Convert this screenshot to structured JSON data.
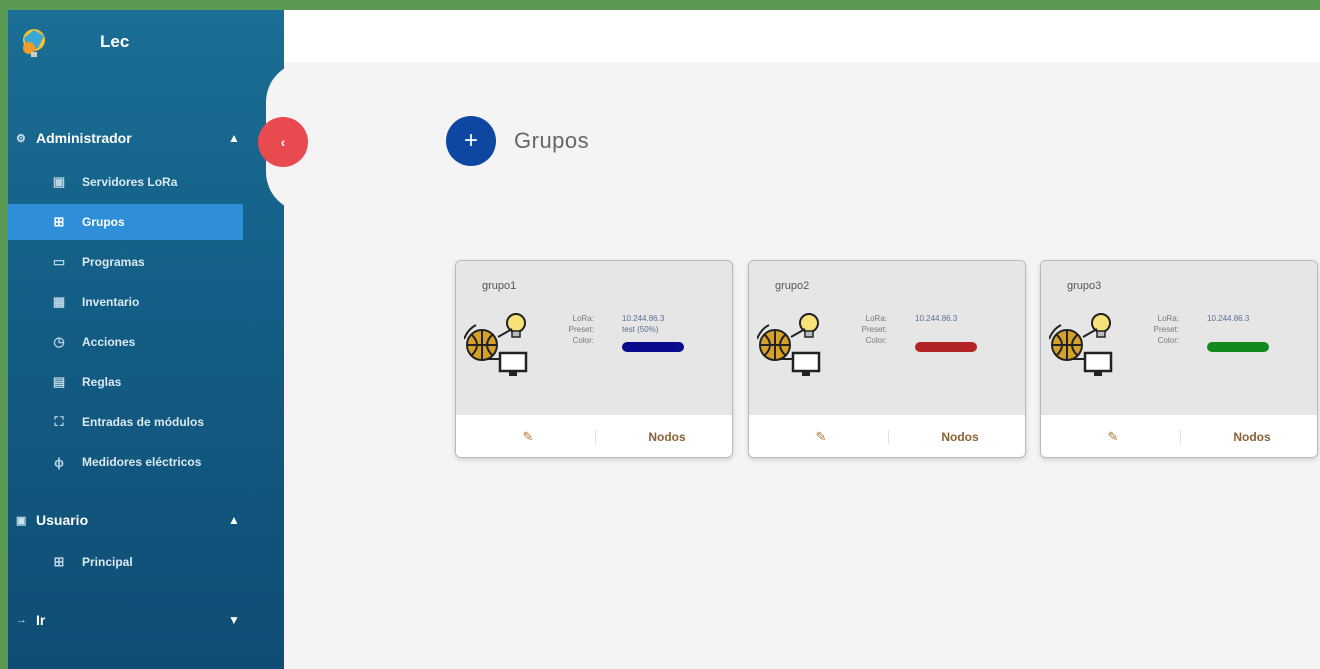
{
  "app": {
    "name": "Lec"
  },
  "sidebar": {
    "collapse_icon": "‹",
    "sections": [
      {
        "label": "Administrador",
        "icon": "⚙",
        "chevron": "▲",
        "items": [
          {
            "label": "Servidores LoRa",
            "icon": "▣"
          },
          {
            "label": "Grupos",
            "icon": "⊞",
            "active": true
          },
          {
            "label": "Programas",
            "icon": "▭"
          },
          {
            "label": "Inventario",
            "icon": "▦"
          },
          {
            "label": "Acciones",
            "icon": "◷"
          },
          {
            "label": "Reglas",
            "icon": "▤"
          },
          {
            "label": "Entradas de módulos",
            "icon": "⛶"
          },
          {
            "label": "Medidores eléctricos",
            "icon": "ϕ"
          }
        ]
      },
      {
        "label": "Usuario",
        "icon": "▣",
        "chevron": "▲",
        "items": [
          {
            "label": "Principal",
            "icon": "⊞"
          }
        ]
      },
      {
        "label": "Ir",
        "icon": "→",
        "chevron": "▼",
        "items": []
      }
    ]
  },
  "page": {
    "title": "Grupos",
    "add_icon": "+"
  },
  "cards": [
    {
      "name": "grupo1",
      "keys": [
        "LoRa:",
        "Preset:",
        "Color:"
      ],
      "vals": [
        "10.244.86.3",
        "test (50%)"
      ],
      "color": "#0a0a8c",
      "edit_icon": "✎",
      "nodos_label": "Nodos"
    },
    {
      "name": "grupo2",
      "keys": [
        "LoRa:",
        "Preset:",
        "Color:"
      ],
      "vals": [
        "10.244.86.3",
        ""
      ],
      "color": "#b32525",
      "edit_icon": "✎",
      "nodos_label": "Nodos"
    },
    {
      "name": "grupo3",
      "keys": [
        "LoRa:",
        "Preset:",
        "Color:"
      ],
      "vals": [
        "10.244.86.3",
        ""
      ],
      "color": "#12891e",
      "edit_icon": "✎",
      "nodos_label": "Nodos"
    }
  ]
}
